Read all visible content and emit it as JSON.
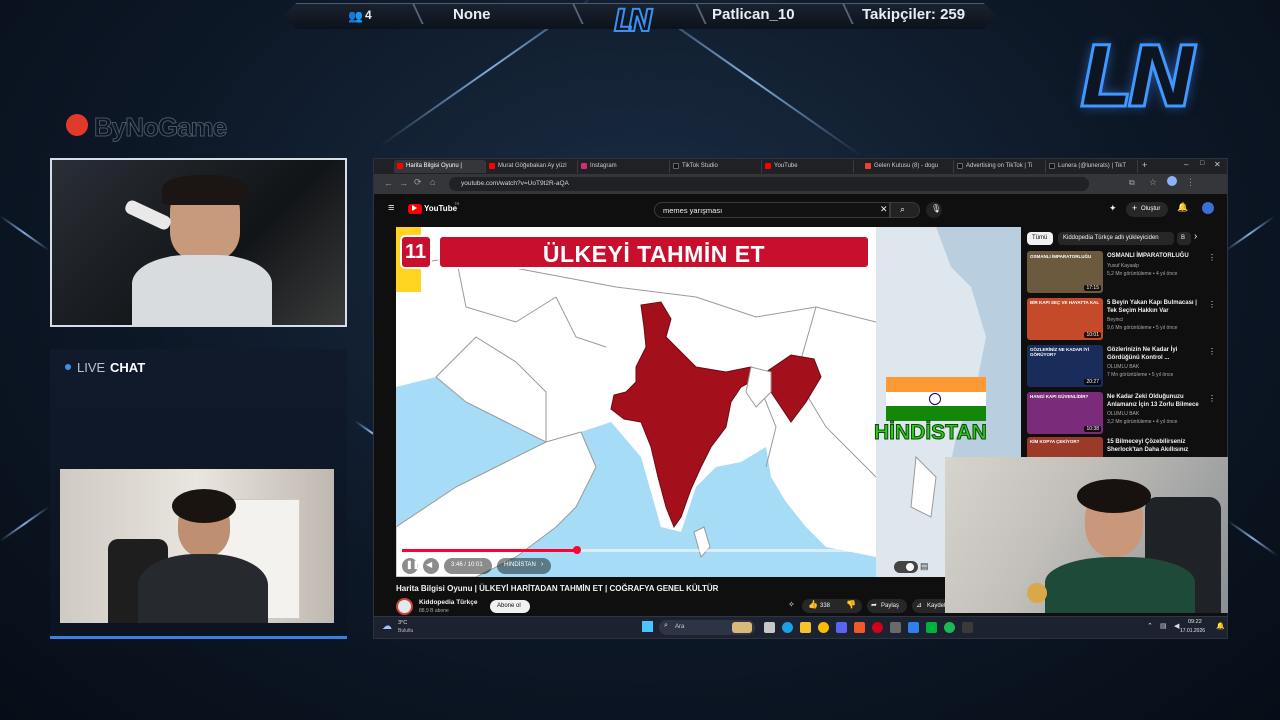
{
  "overlay": {
    "viewer_count": "4",
    "game": "None",
    "streamer": "Patlican_10",
    "followers": "Takipçiler: 259",
    "top_logo": "LN",
    "corner_logo": "LN",
    "sponsor": "ByNoGame",
    "chat_title_live": "LIVE",
    "chat_title_chat": "CHAT"
  },
  "browser": {
    "tabs": [
      {
        "label": "Harita Bilgisi Oyunu |",
        "color": "#ff0000",
        "active": true
      },
      {
        "label": "Murat Göğebakan Ay yüzl",
        "color": "#ff0000",
        "active": false
      },
      {
        "label": "Instagram",
        "color": "#d62976",
        "active": false
      },
      {
        "label": "TikTok Studio",
        "color": "#111111",
        "active": false
      },
      {
        "label": "YouTube",
        "color": "#ff0000",
        "active": false
      },
      {
        "label": "Gelen Kutusu (8) - dogu",
        "color": "#ea4335",
        "active": false
      },
      {
        "label": "Advertising on TikTok | Ti",
        "color": "#111111",
        "active": false
      },
      {
        "label": "Lunera (@lunerats) | TikT",
        "color": "#111111",
        "active": false
      }
    ],
    "url": "youtube.com/watch?v=UoT9t2R-aQA"
  },
  "youtube": {
    "logo_text": "YouTube",
    "logo_sup": "TR",
    "search_value": "memes yarışması",
    "create_label": "Oluştur",
    "video": {
      "number": "11",
      "banner": "ÜLKEYİ TAHMİN ET",
      "answer": "HİNDİSTAN",
      "time": "3:46 / 10:01",
      "chapter": "HİNDİSTAN",
      "progress_fraction": 0.374
    },
    "title": "Harita Bilgisi Oyunu | ÜLKEYİ HARİTADAN TAHMİN ET | COĞRAFYA GENEL KÜLTÜR",
    "channel": "Kiddopedia Türkçe",
    "subscribers": "88,9 B abone",
    "subscribe_label": "Abone ol",
    "likes": "338",
    "share_label": "Paylaş",
    "save_label": "Kaydet",
    "chips": [
      "Tümü",
      "Kiddopedia Türkçe adlı yükleyiciden",
      "B"
    ],
    "sidebar": [
      {
        "title": "OSMANLI İMPARATORLUĞU",
        "channel": "Yusuf Kayaalp",
        "meta": "5,2 Mn görüntüleme • 4 yıl önce",
        "duration": "17:15",
        "thumb": "#6b5a3d"
      },
      {
        "title": "5 Beyin Yakan Kapı Bulmacası | Tek Seçim Hakkın Var",
        "channel": "Beyinci",
        "meta": "9,6 Mn görüntüleme • 5 yıl önce",
        "duration": "10:01",
        "thumb": "#c44a2a"
      },
      {
        "title": "Gözlerinizin Ne Kadar İyi Gördüğünü Kontrol ...",
        "channel": "OLUMLU BAK",
        "meta": "7 Mn görüntüleme • 5 yıl önce",
        "duration": "20:27",
        "thumb": "#1a2d5a"
      },
      {
        "title": "Ne Kadar Zeki Olduğunuzu Anlamanız İçin 13 Zorlu Bilmece",
        "channel": "OLUMLU BAK",
        "meta": "3,2 Mn görüntüleme • 4 yıl önce",
        "duration": "10:38",
        "thumb": "#7a2c7a"
      },
      {
        "title": "15 Bilmeceyi Çözebilirseniz Sherlock'tan Daha Akıllısınız",
        "channel": "",
        "meta": "",
        "duration": "",
        "thumb": "#9c3a2a"
      }
    ],
    "thumb_captions": [
      "OSMANLI İMPARATORLUĞU",
      "BİR KAPI SEÇ VE HAYATTA KAL",
      "GÖZLERİNİZ NE KADAR İYİ GÖRÜYOR?",
      "HANGİ KAPI GÜVENLİDİR?",
      "KİM KOPYA ÇEKİYOR?"
    ]
  },
  "taskbar": {
    "weather_temp": "3°C",
    "weather_label": "Bulutlu",
    "search_placeholder": "Ara",
    "time": "09:22",
    "date": "17.01.2026"
  }
}
